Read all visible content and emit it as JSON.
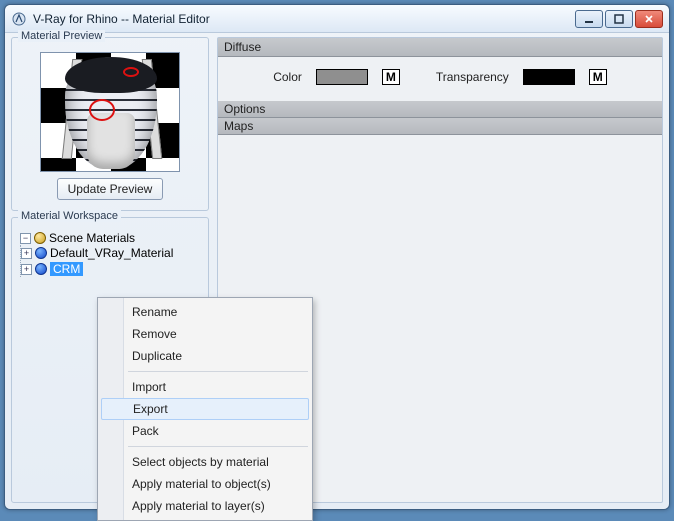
{
  "window": {
    "title": "V-Ray for Rhino -- Material Editor"
  },
  "preview": {
    "legend": "Material Preview",
    "update_btn": "Update Preview"
  },
  "workspace": {
    "legend": "Material Workspace",
    "root": "Scene Materials",
    "items": [
      {
        "label": "Default_VRay_Material"
      },
      {
        "label": "CRM"
      }
    ]
  },
  "panels": {
    "diffuse": {
      "title": "Diffuse",
      "color_label": "Color",
      "color_value": "#8f8f8f",
      "m1": "M",
      "transparency_label": "Transparency",
      "transparency_value": "#000000",
      "m2": "M"
    },
    "options": {
      "title": "Options"
    },
    "maps": {
      "title": "Maps"
    }
  },
  "context_menu": {
    "items": [
      "Rename",
      "Remove",
      "Duplicate",
      "Import",
      "Export",
      "Pack",
      "Select objects by material",
      "Apply material to object(s)",
      "Apply material to layer(s)"
    ],
    "hover_index": 4
  }
}
